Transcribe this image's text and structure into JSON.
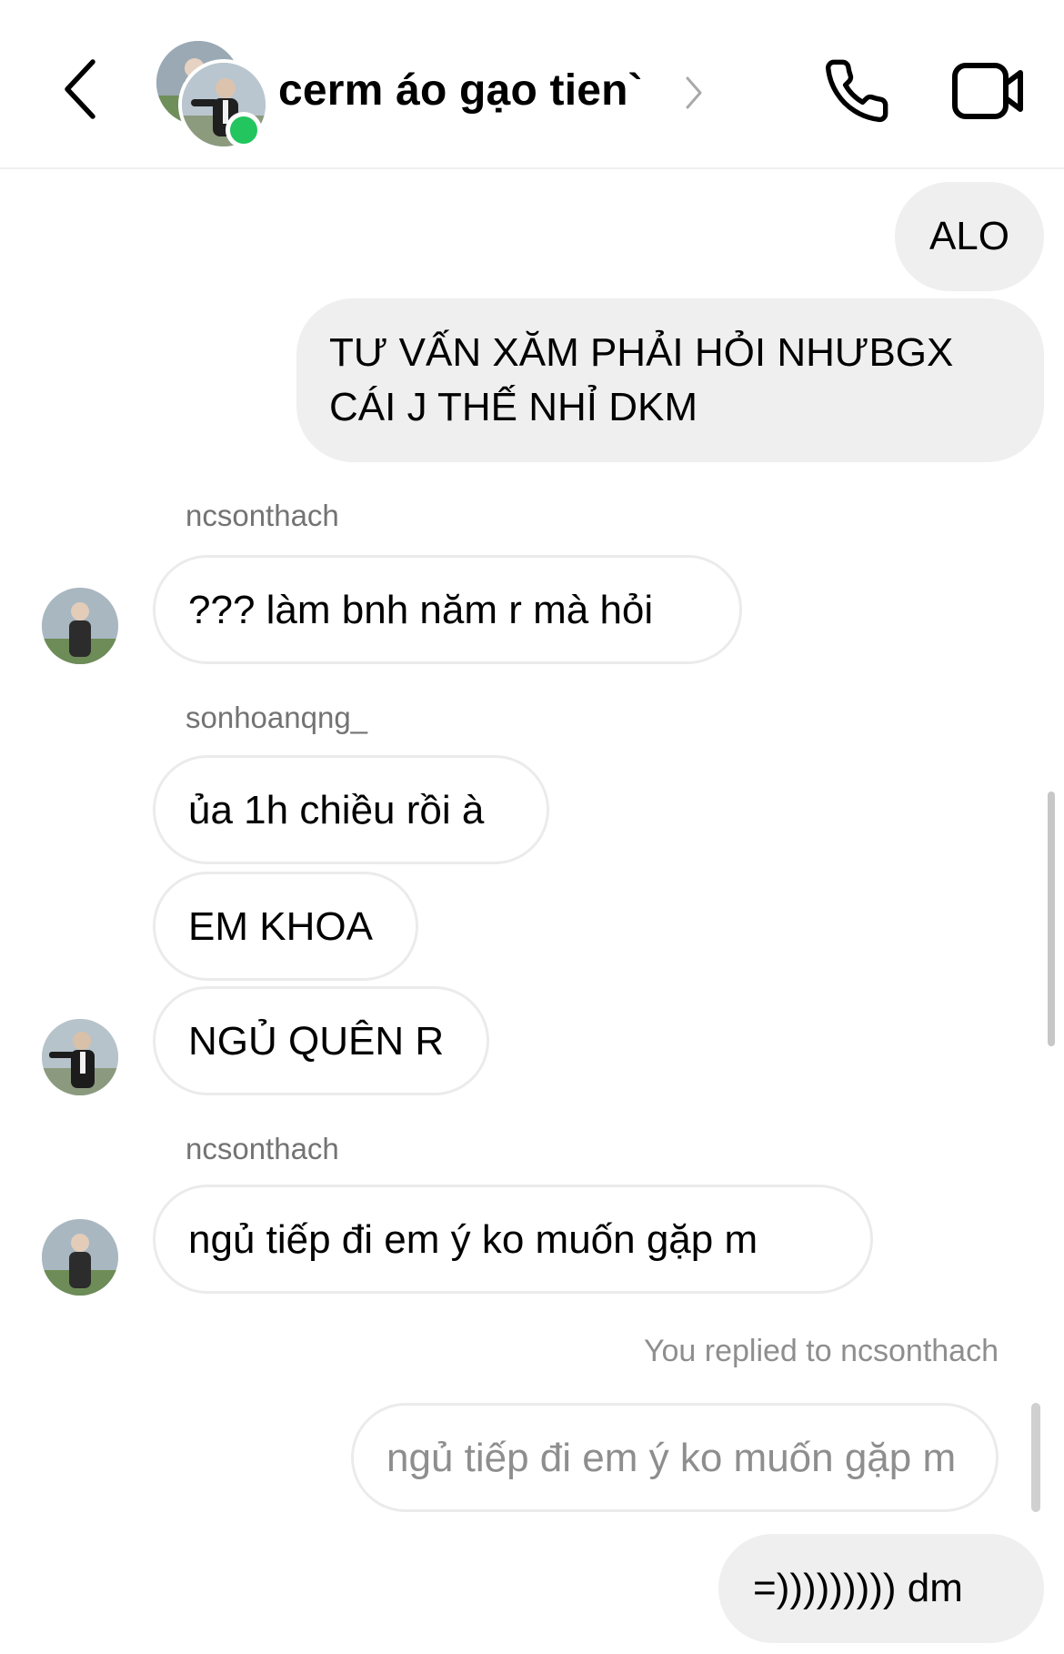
{
  "header": {
    "title": "cerm áo gạo tien`",
    "back_icon": "chevron-left-icon",
    "call_icon": "phone-icon",
    "video_icon": "video-camera-icon",
    "online_status_color": "#22c55e"
  },
  "messages": {
    "m1": {
      "text": "ALO"
    },
    "m2": {
      "line1": "TƯ VẤN XĂM PHẢI HỎI NHƯBGX",
      "line2": "CÁI J THẾ NHỈ DKM"
    },
    "s1": {
      "sender": "ncsonthach"
    },
    "m3": {
      "text": "??? làm bnh năm r mà hỏi"
    },
    "s2": {
      "sender": "sonhoanqng_"
    },
    "m4": {
      "text": "ủa 1h chiều rồi à"
    },
    "m5": {
      "text": "EM KHOA"
    },
    "m6": {
      "text": "NGỦ QUÊN R"
    },
    "s3": {
      "sender": "ncsonthach"
    },
    "m7": {
      "text": "ngủ tiếp đi em ý ko muốn gặp m"
    },
    "reply": {
      "note": "You replied to ncsonthach",
      "quoted": "ngủ tiếp đi em ý ko muốn gặp m"
    },
    "m8": {
      "text": "=))))))))) dm"
    }
  },
  "colors": {
    "my_bubble": "#efefef",
    "their_bubble_border": "#ebebeb",
    "secondary_text": "#737373"
  }
}
